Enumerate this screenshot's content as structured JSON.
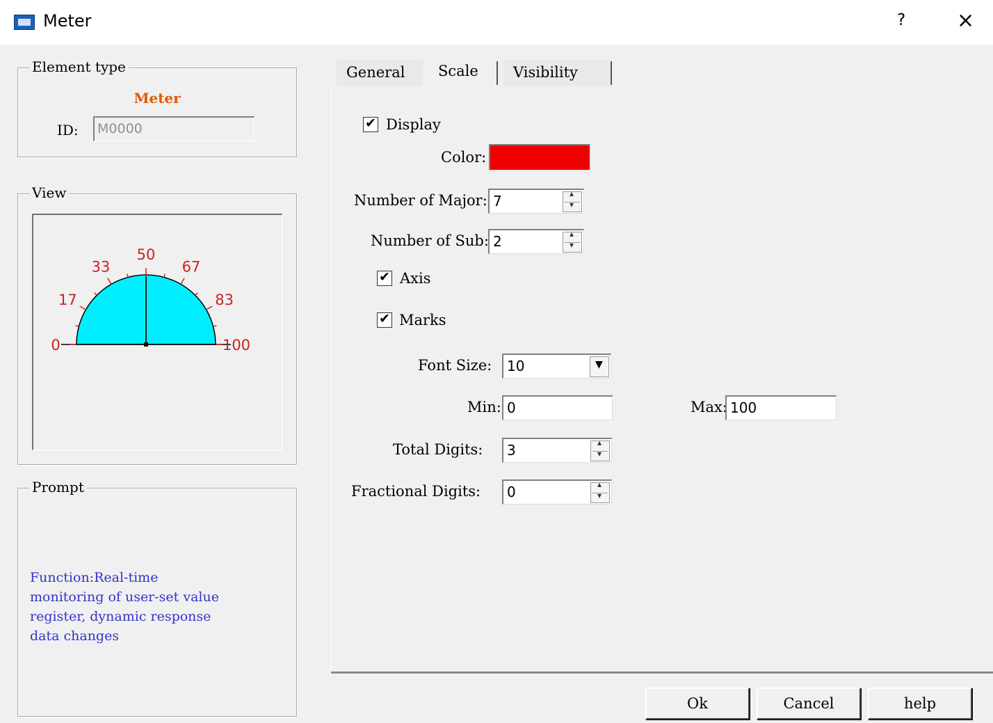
{
  "window": {
    "title": "Meter",
    "help_glyph": "?",
    "close_glyph": "×"
  },
  "element_type": {
    "label": "Element type",
    "value": "Meter",
    "id_label": "ID:",
    "id_value": "M0000"
  },
  "view": {
    "label": "View",
    "gauge": {
      "min": 0,
      "max": 100,
      "tick_labels": [
        "0",
        "17",
        "33",
        "50",
        "67",
        "83",
        "100"
      ],
      "fill_color": "#00eeff",
      "scale_color": "#cc2222",
      "needle_value": 50
    }
  },
  "prompt": {
    "label": "Prompt",
    "lines": [
      "Function:Real-time",
      "monitoring of user-set value",
      "register, dynamic response",
      "data changes"
    ]
  },
  "tabs": [
    {
      "label": "General",
      "active": false
    },
    {
      "label": "Scale",
      "active": true
    },
    {
      "label": "Visibility",
      "active": false
    }
  ],
  "scale": {
    "display_label": "Display",
    "display_checked": true,
    "color_label": "Color:",
    "color_value": "#ee0000",
    "major_label": "Number of Major:",
    "major_value": "7",
    "sub_label": "Number of Sub:",
    "sub_value": "2",
    "axis_label": "Axis",
    "axis_checked": true,
    "marks_label": "Marks",
    "marks_checked": true,
    "font_size_label": "Font Size:",
    "font_size_value": "10",
    "min_label": "Min:",
    "min_value": "0",
    "max_label": "Max:",
    "max_value": "100",
    "total_digits_label": "Total Digits:",
    "total_digits_value": "3",
    "fractional_digits_label": "Fractional Digits:",
    "fractional_digits_value": "0"
  },
  "buttons": {
    "ok": "Ok",
    "cancel": "Cancel",
    "help": "help"
  }
}
